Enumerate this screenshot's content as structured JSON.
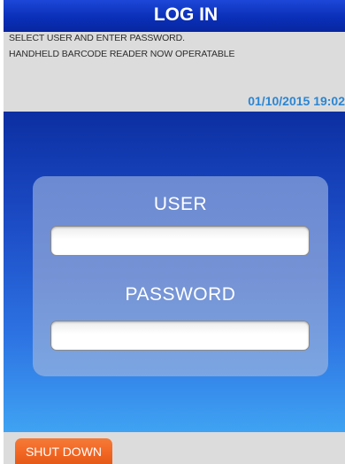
{
  "header": {
    "title": "LOG IN"
  },
  "info": {
    "line1": "SELECT USER AND ENTER PASSWORD.",
    "line2": "HANDHELD BARCODE READER NOW OPERATABLE",
    "datetime": "01/10/2015 19:02"
  },
  "login": {
    "user_label": "USER",
    "user_value": "",
    "password_label": "PASSWORD",
    "password_value": ""
  },
  "footer": {
    "shutdown_label": "SHUT DOWN"
  },
  "colors": {
    "title_bar": "#0a2fb8",
    "datetime": "#2b86d3",
    "shutdown_button": "#f26522",
    "panel_grey": "#dcdcdc"
  }
}
